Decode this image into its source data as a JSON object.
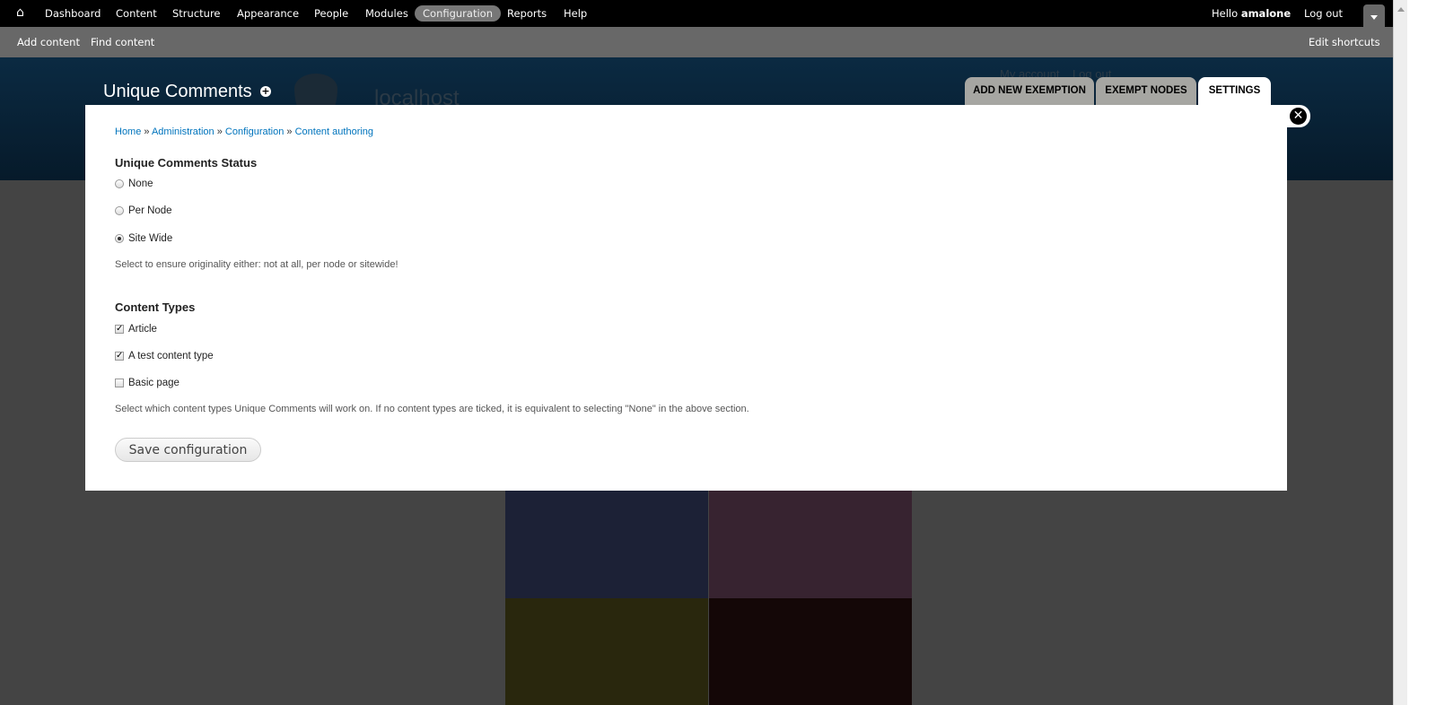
{
  "toolbar": {
    "items": [
      "Dashboard",
      "Content",
      "Structure",
      "Appearance",
      "People",
      "Modules",
      "Configuration",
      "Reports",
      "Help"
    ],
    "active": "Configuration",
    "hello": "Hello",
    "user": "amalone",
    "logout": "Log out"
  },
  "shortcuts": {
    "items": [
      "Add content",
      "Find content"
    ],
    "edit": "Edit shortcuts"
  },
  "header": {
    "title": "Unique Comments",
    "site_name": "localhost",
    "secondary": [
      "My account",
      "Log out"
    ]
  },
  "tabs": [
    "ADD NEW EXEMPTION",
    "EXEMPT NODES",
    "SETTINGS"
  ],
  "breadcrumb": [
    "Home",
    "Administration",
    "Configuration",
    "Content authoring"
  ],
  "status": {
    "title": "Unique Comments Status",
    "options": [
      "None",
      "Per Node",
      "Site Wide"
    ],
    "selected": "Site Wide",
    "description": "Select to ensure originality either: not at all, per node or sitewide!"
  },
  "types": {
    "title": "Content Types",
    "options": [
      {
        "label": "Article",
        "checked": true
      },
      {
        "label": "A test content type",
        "checked": true
      },
      {
        "label": "Basic page",
        "checked": false
      }
    ],
    "description": "Select which content types Unique Comments will work on. If no content types are ticked, it is equivalent to selecting \"None\" in the above section."
  },
  "save_label": "Save configuration"
}
